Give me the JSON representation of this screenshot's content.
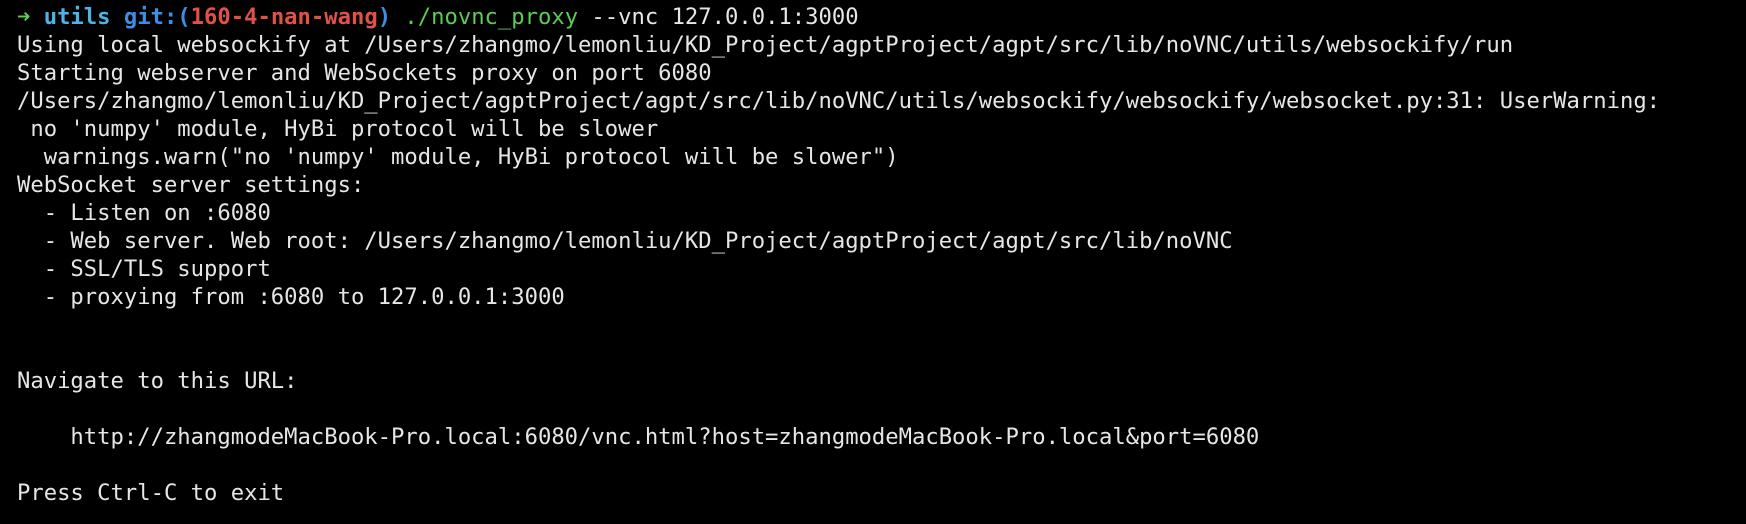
{
  "prompt": {
    "arrow": "➜",
    "directory": "utils",
    "git_label": "git:(",
    "branch": "160-4-nan-wang",
    "git_close": ")",
    "command": "./novnc_proxy",
    "args": " --vnc 127.0.0.1:3000"
  },
  "output": {
    "line1": "Using local websockify at /Users/zhangmo/lemonliu/KD_Project/agptProject/agpt/src/lib/noVNC/utils/websockify/run",
    "line2": "Starting webserver and WebSockets proxy on port 6080",
    "line3": "/Users/zhangmo/lemonliu/KD_Project/agptProject/agpt/src/lib/noVNC/utils/websockify/websockify/websocket.py:31: UserWarning:",
    "line4": " no 'numpy' module, HyBi protocol will be slower",
    "line5": "  warnings.warn(\"no 'numpy' module, HyBi protocol will be slower\")",
    "line6": "WebSocket server settings:",
    "line7": "  - Listen on :6080",
    "line8": "  - Web server. Web root: /Users/zhangmo/lemonliu/KD_Project/agptProject/agpt/src/lib/noVNC",
    "line9": "  - SSL/TLS support",
    "line10": "  - proxying from :6080 to 127.0.0.1:3000",
    "line11": "",
    "line12": "",
    "line13": "Navigate to this URL:",
    "line14": "",
    "line15": "    http://zhangmodeMacBook-Pro.local:6080/vnc.html?host=zhangmodeMacBook-Pro.local&port=6080",
    "line16": "",
    "line17": "Press Ctrl-C to exit"
  },
  "colors": {
    "background": "#000000",
    "text": "#e6e6e6",
    "prompt_arrow": "#5ccc54",
    "directory": "#4fb3e8",
    "git": "#3f8ee6",
    "branch": "#e0514a",
    "command": "#5ccc54"
  }
}
